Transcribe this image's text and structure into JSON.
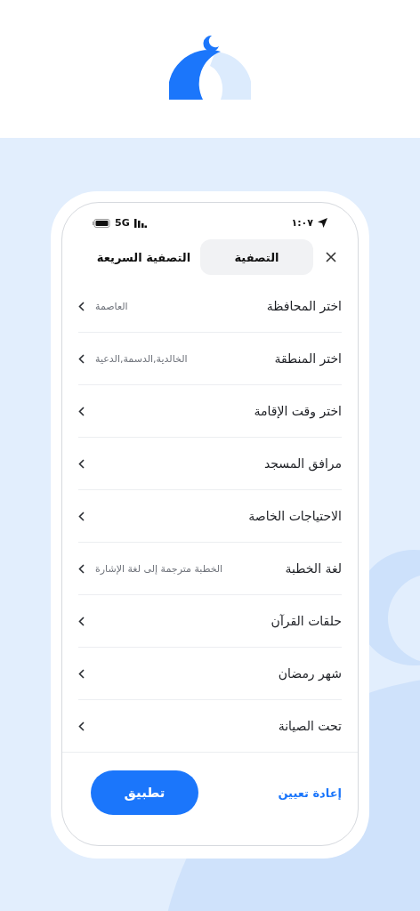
{
  "status_bar": {
    "time": "١:٠٧",
    "network": "5G"
  },
  "tabs": [
    {
      "label": "التصفية",
      "selected": true
    },
    {
      "label": "التصفية السريعة",
      "selected": false
    }
  ],
  "filters": [
    {
      "label": "اختر المحافظة",
      "value": "العاصمة"
    },
    {
      "label": "اختر المنطقة",
      "value": "الخالدية,الدسمة,الدعية"
    },
    {
      "label": "اختر وقت الإقامة"
    },
    {
      "label": "مرافق المسجد"
    },
    {
      "label": "الاحتياجات الخاصة"
    },
    {
      "label": "لغة الخطبة",
      "value": "الخطبة مترجمة إلى لغة الإشارة"
    },
    {
      "label": "حلقات القرآن"
    },
    {
      "label": "شهر رمضان"
    },
    {
      "label": "تحت الصيانة"
    }
  ],
  "footer": {
    "reset": "إعادة تعيين",
    "apply": "تطبيق"
  }
}
